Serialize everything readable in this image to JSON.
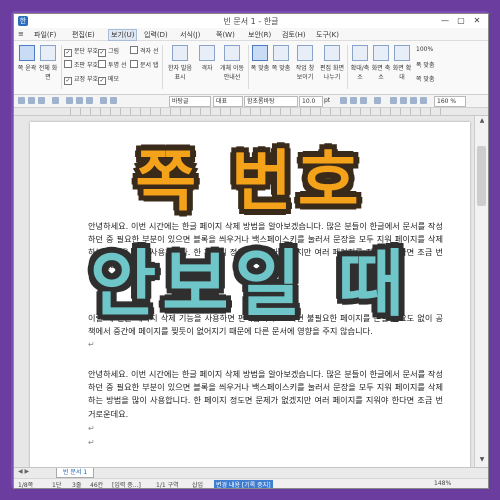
{
  "window": {
    "title": "빈 문서 1 - 한글",
    "buttons": {
      "minimize": "—",
      "maximize": "▢",
      "close": "✕"
    }
  },
  "menu": {
    "items": [
      "파일(F)",
      "편집(E)",
      "보기(U)",
      "입력(D)",
      "서식(J)",
      "쪽(W)",
      "보안(R)",
      "검토(H)",
      "도구(K)"
    ],
    "active_index": 2
  },
  "ribbon": {
    "buttons": [
      {
        "label": "쪽 윤곽",
        "icon": "page-outline-icon"
      },
      {
        "label": "전체 화면",
        "icon": "fullscreen-icon"
      },
      {
        "label": "한자 발음 표시",
        "icon": "hanja-icon"
      },
      {
        "label": "격자",
        "icon": "grid-icon"
      },
      {
        "label": "개체 이동 안내선",
        "icon": "guide-icon"
      },
      {
        "label": "폭 맞춤",
        "icon": "fit-width-icon"
      },
      {
        "label": "쪽 맞춤",
        "icon": "fit-page-icon"
      },
      {
        "label": "작업 창 보이기",
        "icon": "task-pane-icon"
      },
      {
        "label": "편집 화면 나누기",
        "icon": "split-view-icon"
      },
      {
        "label": "확대/축소",
        "icon": "zoom-icon"
      },
      {
        "label": "화면 축소",
        "icon": "zoom-out-icon"
      },
      {
        "label": "화면 확대",
        "icon": "zoom-in-icon"
      }
    ],
    "checks": [
      {
        "label": "문단 부호",
        "checked": true
      },
      {
        "label": "조판 부호",
        "checked": false
      },
      {
        "label": "교정 부호",
        "checked": true
      },
      {
        "label": "그림",
        "checked": true
      },
      {
        "label": "투명 선",
        "checked": false
      },
      {
        "label": "메모",
        "checked": true
      },
      {
        "label": "격자 선",
        "checked": false
      },
      {
        "label": "문서 탭",
        "checked": false
      }
    ],
    "zoom_options": [
      "100%",
      "폭 맞춤",
      "쪽 맞춤"
    ]
  },
  "format_bar": {
    "style": "바탕글",
    "language": "대표",
    "font": "함초롬바탕",
    "size": "10.0",
    "unit": "pt"
  },
  "document": {
    "paragraphs": [
      "안녕하세요. 이번 시간에는 한글 페이지 삭제 방법을 알아보겠습니다. 많은 분들이 한글에서 문서를 작성하던 중 필요한 부분이 있으면 블록을 씌우거나 백스페이스키를 눌러서 문장을 모두 지워 페이지를 삭제하는 방법을 많이 사용합니다. 한 페이지 정도면 문제가 없겠지만 여러 페이지를 지워야 한다면 조금 번거로운데요.",
      "이럴 때 한글 페이지 삭제 기능을 사용하면 편리합니다. 그러면 불필요한 페이지를 손댈 필요도 없이 공책에서 중간에 페이지를 찢듯이 없어지기 때문에 다른 문서에 영향을 주지 않습니다.",
      "안녕하세요. 이번 시간에는 한글 페이지 삭제 방법을 알아보겠습니다. 많은 분들이 한글에서 문서를 작성하던 중 필요한 부분이 있으면 블록을 씌우거나 백스페이스키를 눌러서 문장을 모두 지워 페이지를 삭제하는 방법을 많이 사용합니다. 한 페이지 정도면 문제가 없겠지만 여러 페이지를 지워야 한다면 조금 번거로운데요."
    ],
    "para_mark": "↵"
  },
  "overlay": {
    "line1": "쪽 번호",
    "line2": "안보일 때"
  },
  "tabs": {
    "items": [
      "빈 문서 1"
    ]
  },
  "status": {
    "page": "1/8쪽",
    "section": "1단",
    "line": "3줄",
    "col": "46칸",
    "input": "[입력 중...]",
    "sect": "1/1 구역",
    "mode": "삽입",
    "track": "변경 내용 [기록 중지]",
    "zoom": "148%"
  },
  "colors": {
    "overlay1": "#f5a21b",
    "overlay2": "#6ec6c9",
    "frame": "#7b4cb6"
  }
}
